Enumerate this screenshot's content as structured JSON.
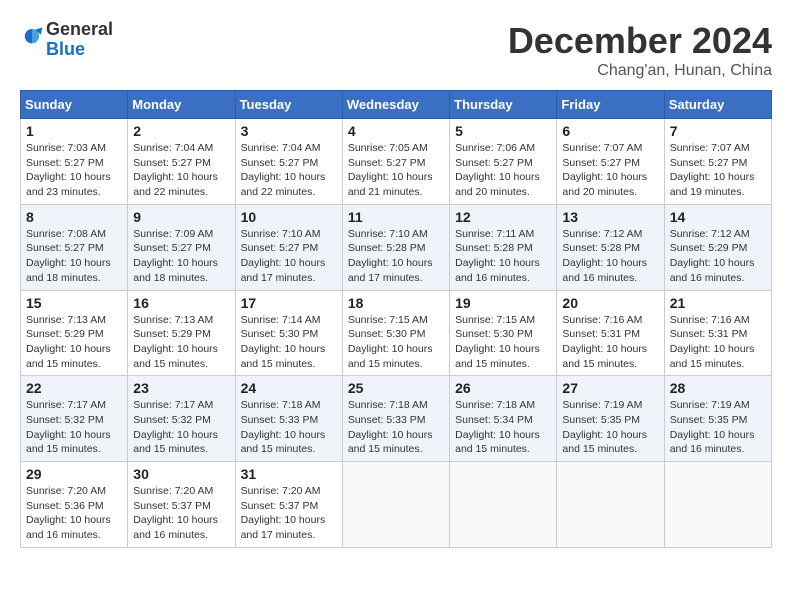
{
  "logo": {
    "general": "General",
    "blue": "Blue"
  },
  "header": {
    "month": "December 2024",
    "location": "Chang'an, Hunan, China"
  },
  "weekdays": [
    "Sunday",
    "Monday",
    "Tuesday",
    "Wednesday",
    "Thursday",
    "Friday",
    "Saturday"
  ],
  "weeks": [
    [
      {
        "day": "1",
        "sunrise": "7:03 AM",
        "sunset": "5:27 PM",
        "daylight": "10 hours and 23 minutes."
      },
      {
        "day": "2",
        "sunrise": "7:04 AM",
        "sunset": "5:27 PM",
        "daylight": "10 hours and 22 minutes."
      },
      {
        "day": "3",
        "sunrise": "7:04 AM",
        "sunset": "5:27 PM",
        "daylight": "10 hours and 22 minutes."
      },
      {
        "day": "4",
        "sunrise": "7:05 AM",
        "sunset": "5:27 PM",
        "daylight": "10 hours and 21 minutes."
      },
      {
        "day": "5",
        "sunrise": "7:06 AM",
        "sunset": "5:27 PM",
        "daylight": "10 hours and 20 minutes."
      },
      {
        "day": "6",
        "sunrise": "7:07 AM",
        "sunset": "5:27 PM",
        "daylight": "10 hours and 20 minutes."
      },
      {
        "day": "7",
        "sunrise": "7:07 AM",
        "sunset": "5:27 PM",
        "daylight": "10 hours and 19 minutes."
      }
    ],
    [
      {
        "day": "8",
        "sunrise": "7:08 AM",
        "sunset": "5:27 PM",
        "daylight": "10 hours and 18 minutes."
      },
      {
        "day": "9",
        "sunrise": "7:09 AM",
        "sunset": "5:27 PM",
        "daylight": "10 hours and 18 minutes."
      },
      {
        "day": "10",
        "sunrise": "7:10 AM",
        "sunset": "5:27 PM",
        "daylight": "10 hours and 17 minutes."
      },
      {
        "day": "11",
        "sunrise": "7:10 AM",
        "sunset": "5:28 PM",
        "daylight": "10 hours and 17 minutes."
      },
      {
        "day": "12",
        "sunrise": "7:11 AM",
        "sunset": "5:28 PM",
        "daylight": "10 hours and 16 minutes."
      },
      {
        "day": "13",
        "sunrise": "7:12 AM",
        "sunset": "5:28 PM",
        "daylight": "10 hours and 16 minutes."
      },
      {
        "day": "14",
        "sunrise": "7:12 AM",
        "sunset": "5:29 PM",
        "daylight": "10 hours and 16 minutes."
      }
    ],
    [
      {
        "day": "15",
        "sunrise": "7:13 AM",
        "sunset": "5:29 PM",
        "daylight": "10 hours and 15 minutes."
      },
      {
        "day": "16",
        "sunrise": "7:13 AM",
        "sunset": "5:29 PM",
        "daylight": "10 hours and 15 minutes."
      },
      {
        "day": "17",
        "sunrise": "7:14 AM",
        "sunset": "5:30 PM",
        "daylight": "10 hours and 15 minutes."
      },
      {
        "day": "18",
        "sunrise": "7:15 AM",
        "sunset": "5:30 PM",
        "daylight": "10 hours and 15 minutes."
      },
      {
        "day": "19",
        "sunrise": "7:15 AM",
        "sunset": "5:30 PM",
        "daylight": "10 hours and 15 minutes."
      },
      {
        "day": "20",
        "sunrise": "7:16 AM",
        "sunset": "5:31 PM",
        "daylight": "10 hours and 15 minutes."
      },
      {
        "day": "21",
        "sunrise": "7:16 AM",
        "sunset": "5:31 PM",
        "daylight": "10 hours and 15 minutes."
      }
    ],
    [
      {
        "day": "22",
        "sunrise": "7:17 AM",
        "sunset": "5:32 PM",
        "daylight": "10 hours and 15 minutes."
      },
      {
        "day": "23",
        "sunrise": "7:17 AM",
        "sunset": "5:32 PM",
        "daylight": "10 hours and 15 minutes."
      },
      {
        "day": "24",
        "sunrise": "7:18 AM",
        "sunset": "5:33 PM",
        "daylight": "10 hours and 15 minutes."
      },
      {
        "day": "25",
        "sunrise": "7:18 AM",
        "sunset": "5:33 PM",
        "daylight": "10 hours and 15 minutes."
      },
      {
        "day": "26",
        "sunrise": "7:18 AM",
        "sunset": "5:34 PM",
        "daylight": "10 hours and 15 minutes."
      },
      {
        "day": "27",
        "sunrise": "7:19 AM",
        "sunset": "5:35 PM",
        "daylight": "10 hours and 15 minutes."
      },
      {
        "day": "28",
        "sunrise": "7:19 AM",
        "sunset": "5:35 PM",
        "daylight": "10 hours and 16 minutes."
      }
    ],
    [
      {
        "day": "29",
        "sunrise": "7:20 AM",
        "sunset": "5:36 PM",
        "daylight": "10 hours and 16 minutes."
      },
      {
        "day": "30",
        "sunrise": "7:20 AM",
        "sunset": "5:37 PM",
        "daylight": "10 hours and 16 minutes."
      },
      {
        "day": "31",
        "sunrise": "7:20 AM",
        "sunset": "5:37 PM",
        "daylight": "10 hours and 17 minutes."
      },
      null,
      null,
      null,
      null
    ]
  ],
  "labels": {
    "sunrise": "Sunrise:",
    "sunset": "Sunset:",
    "daylight": "Daylight:"
  }
}
